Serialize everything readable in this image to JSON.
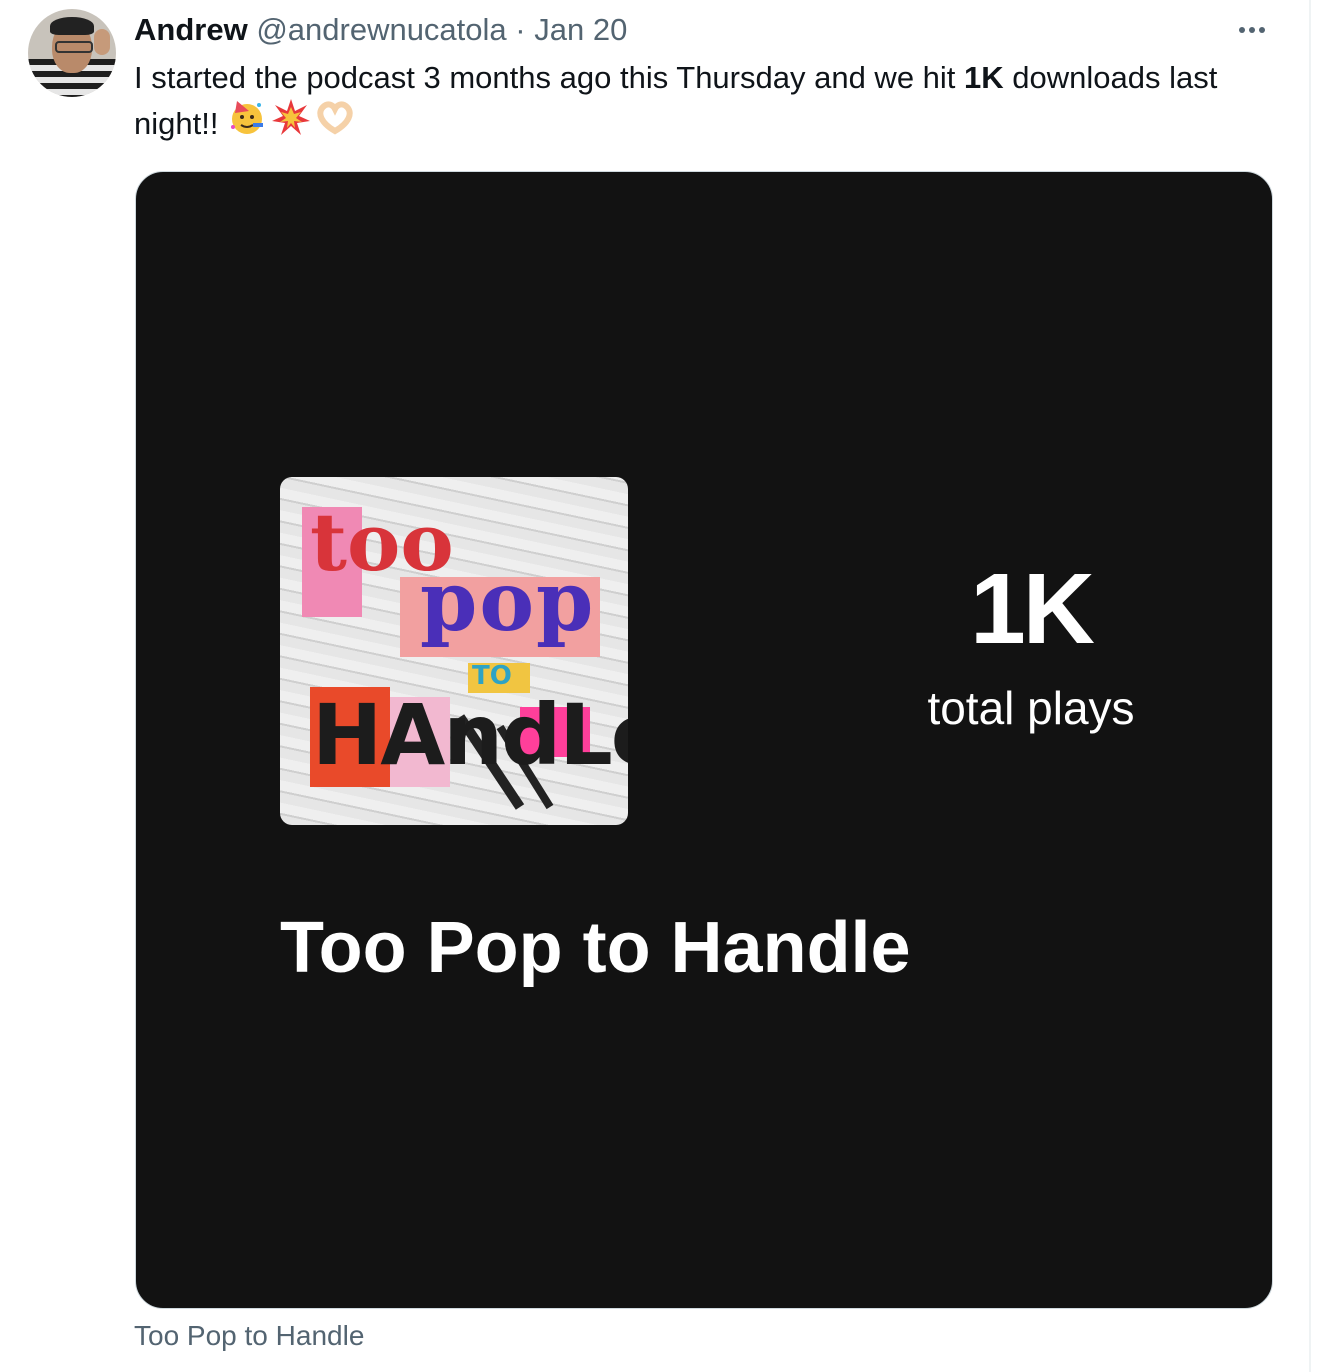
{
  "tweet": {
    "author_name": "Andrew",
    "author_handle": "@andrewnucatola",
    "separator": "·",
    "date": "Jan 20",
    "text_before_bold": "I started the podcast 3 months ago this Thursday and we hit ",
    "text_bold": "1K",
    "text_after_bold": " downloads last night!!",
    "emojis": [
      "partying-face",
      "collision",
      "heart-hands"
    ]
  },
  "card": {
    "cover_art": {
      "line1": "too",
      "line2": "pop",
      "line3": "TO",
      "line4": "HAndLe"
    },
    "stat_value": "1K",
    "stat_label": "total plays",
    "show_title": "Too Pop to Handle",
    "caption": "Too Pop to Handle"
  },
  "colors": {
    "card_background": "#121212",
    "secondary_text": "#536471",
    "primary_text": "#0f1419"
  }
}
